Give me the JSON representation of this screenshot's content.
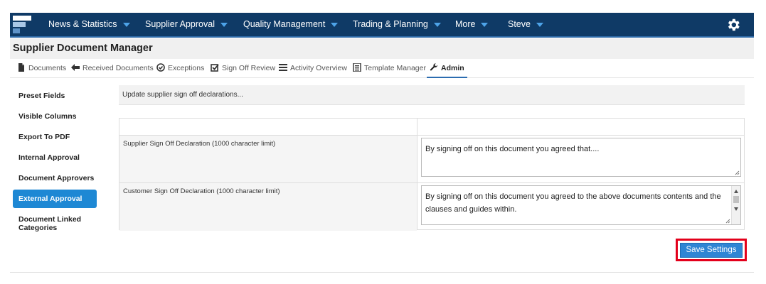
{
  "nav": {
    "items": [
      {
        "label": "News & Statistics"
      },
      {
        "label": "Supplier Approval"
      },
      {
        "label": "Quality Management"
      },
      {
        "label": "Trading & Planning"
      },
      {
        "label": "More"
      },
      {
        "label": "Steve"
      }
    ],
    "settings_icon": "gear-icon"
  },
  "page": {
    "title": "Supplier Document Manager"
  },
  "tabs": [
    {
      "label": "Documents",
      "icon": "document-icon"
    },
    {
      "label": "Received Documents",
      "icon": "arrow-left-icon"
    },
    {
      "label": "Exceptions",
      "icon": "circle-check-icon"
    },
    {
      "label": "Sign Off Review",
      "icon": "checkbox-icon"
    },
    {
      "label": "Activity Overview",
      "icon": "list-icon"
    },
    {
      "label": "Template Manager",
      "icon": "template-icon"
    },
    {
      "label": "Admin",
      "icon": "wrench-icon",
      "active": true
    }
  ],
  "sidebar": {
    "items": [
      {
        "label": "Preset Fields"
      },
      {
        "label": "Visible Columns"
      },
      {
        "label": "Export To PDF"
      },
      {
        "label": "Internal Approval"
      },
      {
        "label": "Document Approvers"
      },
      {
        "label": "External Approval",
        "active": true
      },
      {
        "label": "Document Linked Categories"
      }
    ]
  },
  "content": {
    "hint": "Update supplier sign off declarations...",
    "rows": [
      {
        "label": "Supplier Sign Off Declaration (1000 character limit)",
        "value": "By signing off on this document you agreed that...."
      },
      {
        "label": "Customer Sign Off Declaration (1000 character limit)",
        "value": "By signing off on this document you agreed to the above documents contents and the clauses and guides within."
      }
    ],
    "save_label": "Save Settings"
  },
  "colors": {
    "nav_bg": "#0f3a66",
    "accent": "#1e88d4",
    "highlight": "#e3001b"
  }
}
